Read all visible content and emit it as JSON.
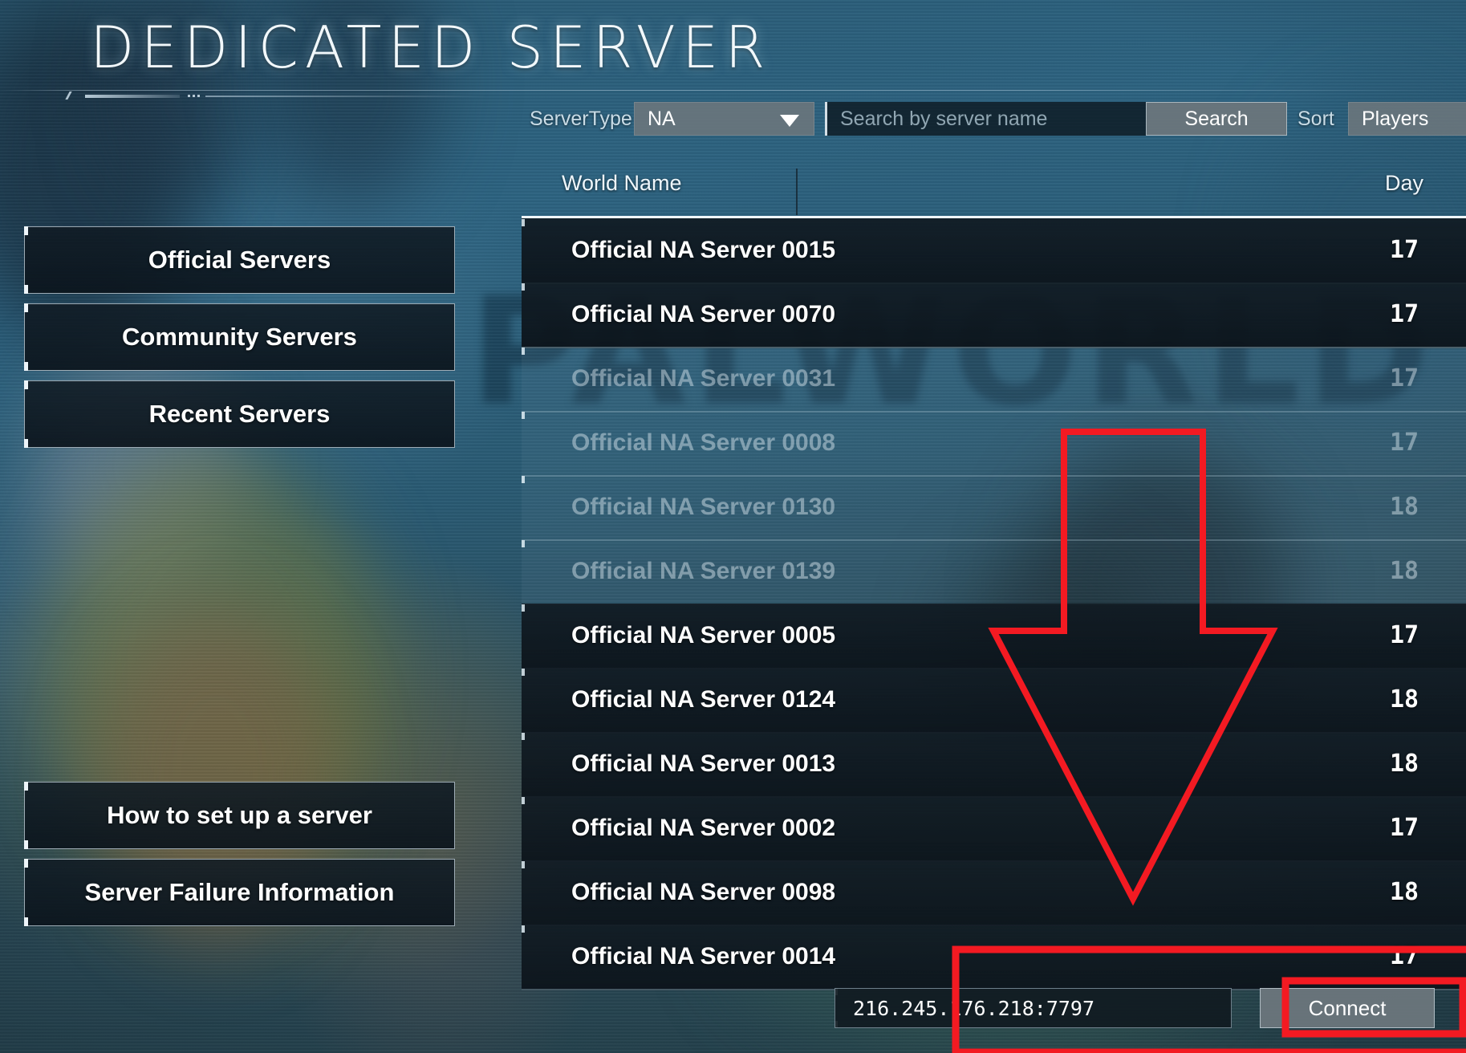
{
  "header": {
    "title": "DEDICATED SERVER"
  },
  "toolbar": {
    "servertype_label": "ServerType",
    "servertype_value": "NA",
    "search_placeholder": "Search by server name",
    "search_value": "",
    "search_button": "Search",
    "sort_label": "Sort",
    "sort_value": "Players"
  },
  "sidebar": {
    "items": [
      {
        "label": "Official Servers"
      },
      {
        "label": "Community Servers"
      },
      {
        "label": "Recent Servers"
      },
      {
        "label": "How to set up a server"
      },
      {
        "label": "Server Failure Information"
      }
    ]
  },
  "list": {
    "columns": {
      "world_name": "World Name",
      "day": "Day"
    },
    "rows": [
      {
        "name": "Official NA Server 0015",
        "day": "17",
        "state": "opaque"
      },
      {
        "name": "Official NA Server 0070",
        "day": "17",
        "state": "opaque"
      },
      {
        "name": "Official NA Server 0031",
        "day": "17",
        "state": "faded"
      },
      {
        "name": "Official NA Server 0008",
        "day": "17",
        "state": "faded"
      },
      {
        "name": "Official NA Server 0130",
        "day": "18",
        "state": "faded"
      },
      {
        "name": "Official NA Server 0139",
        "day": "18",
        "state": "faded"
      },
      {
        "name": "Official NA Server 0005",
        "day": "17",
        "state": "opaque"
      },
      {
        "name": "Official NA Server 0124",
        "day": "18",
        "state": "opaque"
      },
      {
        "name": "Official NA Server 0013",
        "day": "18",
        "state": "opaque"
      },
      {
        "name": "Official NA Server 0002",
        "day": "17",
        "state": "opaque"
      },
      {
        "name": "Official NA Server 0098",
        "day": "18",
        "state": "opaque"
      },
      {
        "name": "Official NA Server 0014",
        "day": "17",
        "state": "opaque"
      }
    ]
  },
  "connect": {
    "ip_value": "216.245.176.218:7797",
    "connect_button": "Connect"
  },
  "background": {
    "watermark": "PALWORLD"
  },
  "annotation": {
    "color": "#f31a22",
    "arrow_name": "red-down-arrow",
    "box_outer_name": "red-highlight-box-connect-bar",
    "box_inner_name": "red-highlight-box-connect-button"
  },
  "icons": {
    "dropdown_caret": "chevron-down-icon"
  }
}
